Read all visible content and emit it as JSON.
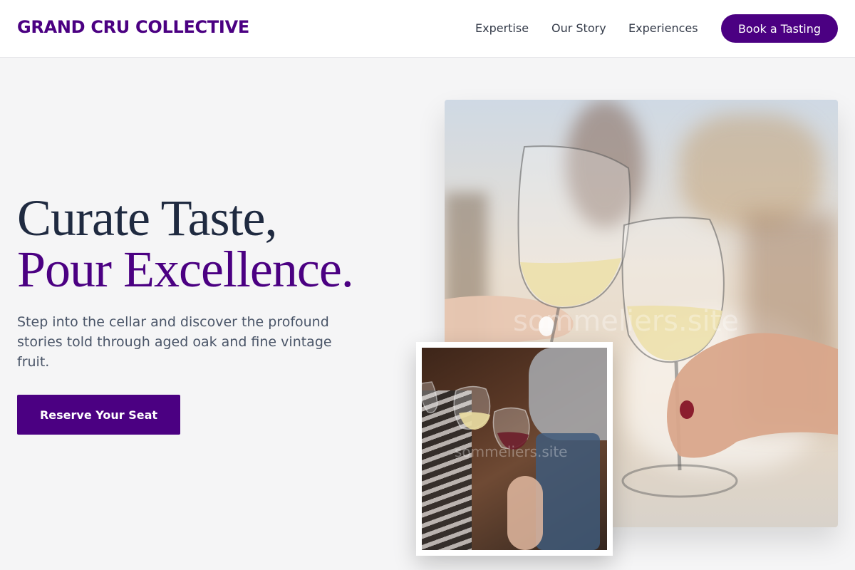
{
  "nav": {
    "logo": "GRAND CRU COLLECTIVE",
    "links": [
      "Expertise",
      "Our Story",
      "Experiences"
    ],
    "cta": "Book a Tasting"
  },
  "hero": {
    "title_line1": "Curate Taste,",
    "title_line2": "Pour Excellence.",
    "subtitle": "Step into the cellar and discover the profound stories told through aged oak and fine vintage fruit.",
    "cta": "Reserve Your Seat"
  },
  "images": {
    "main_watermark": "sommeliers.site",
    "small_watermark": "sommeliers.site"
  },
  "colors": {
    "brand": "#4b0082",
    "heading": "#1f2a40",
    "body_text": "#4a5568"
  }
}
